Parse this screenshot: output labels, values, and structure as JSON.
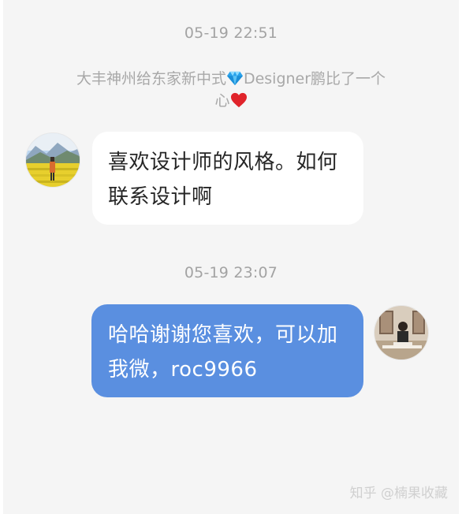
{
  "chat": {
    "timestamp_1": "05-19 22:51",
    "notice_part_1": "大丰神州给东家新中式",
    "notice_part_2": "Designer鹏比了一个",
    "notice_part_3": "心",
    "notice_gem_icon": "gem-icon",
    "notice_heart_icon": "red-heart-icon",
    "incoming_message": "喜欢设计师的风格。如何\n联系设计啊",
    "timestamp_2": "05-19 23:07",
    "outgoing_message": "哈哈谢谢您喜欢，可以加\n我微，roc9966"
  },
  "watermark": {
    "text": "知乎 @楠果收藏"
  },
  "colors": {
    "panel_background": "#f5f5f5",
    "outgoing_bubble": "#5a8fe0",
    "incoming_bubble": "#ffffff",
    "timestamp_text": "#a3a3a3"
  }
}
